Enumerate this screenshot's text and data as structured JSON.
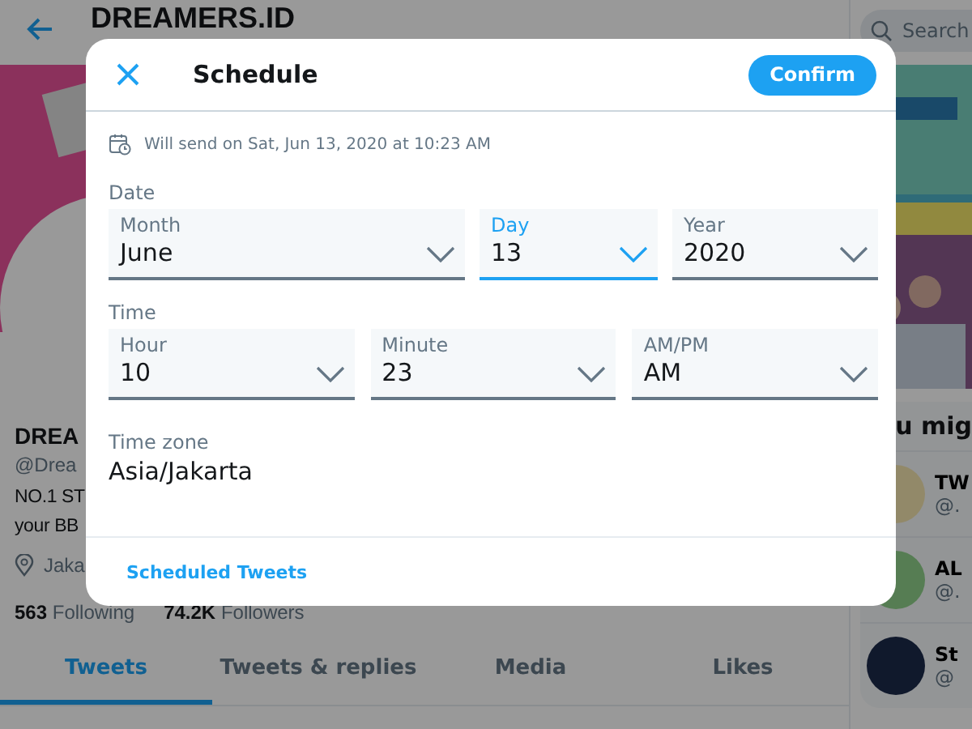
{
  "profile_header": {
    "name": "DREAMERS.ID"
  },
  "profile": {
    "name": "DREA",
    "handle": "@Drea",
    "bio": [
      "NO.1 ST",
      "your BB"
    ],
    "location": "Jaka",
    "following_count": "563",
    "following_label": "Following",
    "followers_count": "74.2K",
    "followers_label": "Followers"
  },
  "profile_tabs": [
    {
      "label": "Tweets",
      "selected": true
    },
    {
      "label": "Tweets & replies",
      "selected": false
    },
    {
      "label": "Media",
      "selected": false
    },
    {
      "label": "Likes",
      "selected": false
    }
  ],
  "sidebar": {
    "search_placeholder": "Search",
    "section_title": "u mig",
    "accounts": [
      {
        "name": "TW",
        "handle": "@."
      },
      {
        "name": "AL",
        "handle": "@."
      },
      {
        "name": "St",
        "handle": "@"
      }
    ]
  },
  "dialog": {
    "title": "Schedule",
    "confirm": "Confirm",
    "info": "Will send on Sat, Jun 13, 2020 at 10:23 AM",
    "date_label": "Date",
    "date_fields": [
      {
        "label": "Month",
        "value": "June",
        "focused": false
      },
      {
        "label": "Day",
        "value": "13",
        "focused": true
      },
      {
        "label": "Year",
        "value": "2020",
        "focused": false
      }
    ],
    "time_label": "Time",
    "time_fields": [
      {
        "label": "Hour",
        "value": "10",
        "focused": false
      },
      {
        "label": "Minute",
        "value": "23",
        "focused": false
      },
      {
        "label": "AM/PM",
        "value": "AM",
        "focused": false
      }
    ],
    "timezone_label": "Time zone",
    "timezone": "Asia/Jakarta",
    "footer_link": "Scheduled Tweets"
  }
}
